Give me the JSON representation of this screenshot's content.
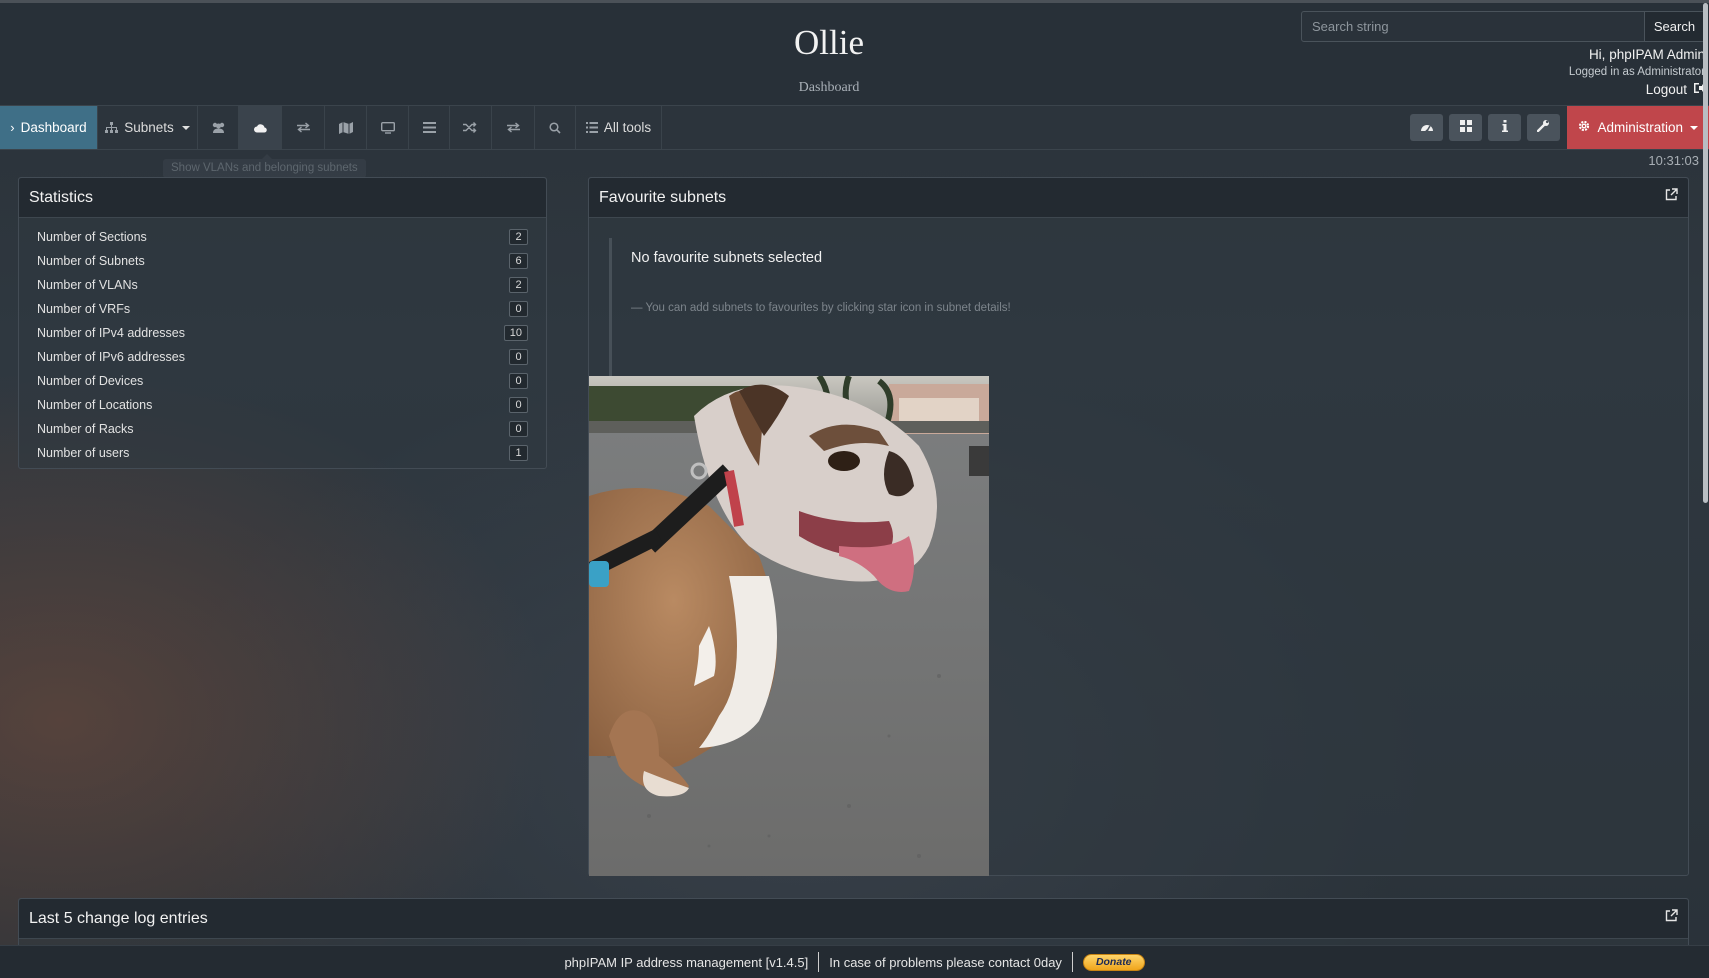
{
  "header": {
    "site_title": "Ollie",
    "site_subtitle": "Dashboard",
    "search_placeholder": "Search string",
    "search_button": "Search",
    "greeting": "Hi, phpIPAM Admin",
    "logged_in_as": "Logged in as  Administrator",
    "logout": "Logout"
  },
  "nav": {
    "items": [
      {
        "label": "Dashboard",
        "icon": "chevron-right-icon",
        "active": true
      },
      {
        "label": "Subnets",
        "icon": "sitemap-icon",
        "dropdown": true
      },
      {
        "label": "",
        "icon": "users-icon"
      },
      {
        "label": "",
        "icon": "cloud-icon",
        "hover": true
      },
      {
        "label": "",
        "icon": "exchange-icon"
      },
      {
        "label": "",
        "icon": "map-icon"
      },
      {
        "label": "",
        "icon": "desktop-icon"
      },
      {
        "label": "",
        "icon": "bars-icon"
      },
      {
        "label": "",
        "icon": "random-icon"
      },
      {
        "label": "",
        "icon": "exchange-icon"
      },
      {
        "label": "",
        "icon": "search-icon"
      },
      {
        "label": "All tools",
        "icon": "list-icon"
      }
    ],
    "right_icons": [
      "dashboard-gauge-icon",
      "grid-icon",
      "info-icon",
      "wrench-icon"
    ],
    "admin_label": "Administration",
    "tooltip": "Show VLANs and belonging subnets"
  },
  "clock": "10:31:03",
  "statistics": {
    "title": "Statistics",
    "rows": [
      {
        "label": "Number of Sections",
        "value": "2"
      },
      {
        "label": "Number of Subnets",
        "value": "6"
      },
      {
        "label": "Number of VLANs",
        "value": "2"
      },
      {
        "label": "Number of VRFs",
        "value": "0"
      },
      {
        "label": "Number of IPv4 addresses",
        "value": "10"
      },
      {
        "label": "Number of IPv6 addresses",
        "value": "0"
      },
      {
        "label": "Number of Devices",
        "value": "0"
      },
      {
        "label": "Number of Locations",
        "value": "0"
      },
      {
        "label": "Number of Racks",
        "value": "0"
      },
      {
        "label": "Number of users",
        "value": "1"
      }
    ]
  },
  "favourites": {
    "title": "Favourite subnets",
    "empty_title": "No favourite subnets selected",
    "empty_hint": "— You can add subnets to favourites by clicking star icon in subnet details!"
  },
  "changelog": {
    "title": "Last 5 change log entries"
  },
  "footer": {
    "app": "phpIPAM IP address management [v1.4.5]",
    "contact": "In case of problems please contact 0day",
    "donate": "Donate"
  },
  "colors": {
    "accent": "#3f6f87",
    "admin": "#c0464b",
    "header_bg": "#283038"
  }
}
